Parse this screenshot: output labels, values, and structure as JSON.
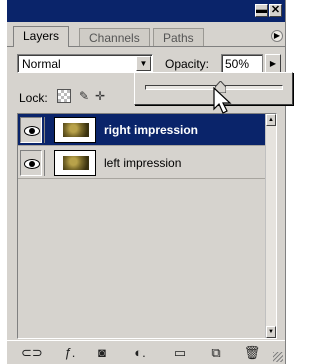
{
  "tabs": [
    {
      "label": "Layers",
      "active": true
    },
    {
      "label": "Channels",
      "active": false
    },
    {
      "label": "Paths",
      "active": false
    }
  ],
  "blend_mode": {
    "value": "Normal"
  },
  "opacity": {
    "label": "Opacity:",
    "value": "50%",
    "slider_fraction": 0.5
  },
  "lock": {
    "label": "Lock:"
  },
  "layers": [
    {
      "name": "right impression",
      "visible": true,
      "selected": true
    },
    {
      "name": "left impression",
      "visible": true,
      "selected": false
    }
  ],
  "colors": {
    "title_bar": "#0a246a",
    "selection": "#0a246a",
    "panel": "#d6d3ce"
  },
  "icons": {
    "title_minimize": "minimize-icon",
    "title_close": "close-icon",
    "palette_menu": "panel-menu-icon",
    "bottom": [
      "link-icon",
      "layer-style-icon",
      "add-mask-icon",
      "adjustment-layer-icon",
      "new-set-icon",
      "new-layer-icon",
      "trash-icon"
    ]
  }
}
